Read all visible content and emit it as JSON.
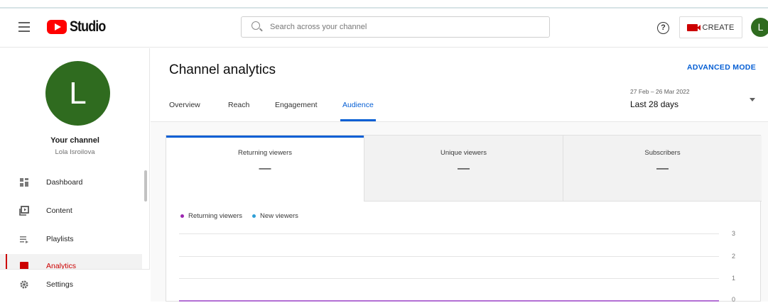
{
  "header": {
    "logo_text": "Studio",
    "search_placeholder": "Search across your channel",
    "create_label": "CREATE",
    "avatar_letter": "L"
  },
  "sidebar": {
    "avatar_letter": "L",
    "channel_title": "Your channel",
    "channel_name": "Lola Isroilova",
    "items": [
      {
        "label": "Dashboard",
        "icon": "dashboard-icon"
      },
      {
        "label": "Content",
        "icon": "content-icon"
      },
      {
        "label": "Playlists",
        "icon": "playlists-icon"
      },
      {
        "label": "Analytics",
        "icon": "analytics-icon",
        "active": true
      },
      {
        "label": "Settings",
        "icon": "settings-icon"
      }
    ]
  },
  "main": {
    "title": "Channel analytics",
    "advanced_mode": "ADVANCED MODE",
    "tabs": [
      {
        "label": "Overview"
      },
      {
        "label": "Reach"
      },
      {
        "label": "Engagement"
      },
      {
        "label": "Audience",
        "active": true
      }
    ],
    "date_range": {
      "dates": "27 Feb – 26 Mar 2022",
      "label": "Last 28 days"
    },
    "metrics": [
      {
        "label": "Returning viewers",
        "value": "—",
        "selected": true
      },
      {
        "label": "Unique viewers",
        "value": "—"
      },
      {
        "label": "Subscribers",
        "value": "—"
      }
    ],
    "legend": [
      {
        "label": "Returning viewers",
        "color": "#9c27b0"
      },
      {
        "label": "New viewers",
        "color": "#2f9fd6"
      }
    ],
    "y_ticks": [
      "3",
      "2",
      "1",
      "0"
    ]
  },
  "colors": {
    "accent": "#065fd4",
    "brand_red": "#ff0000",
    "avatar_green": "#2f6b1f",
    "returning_series": "#b26fd4"
  }
}
